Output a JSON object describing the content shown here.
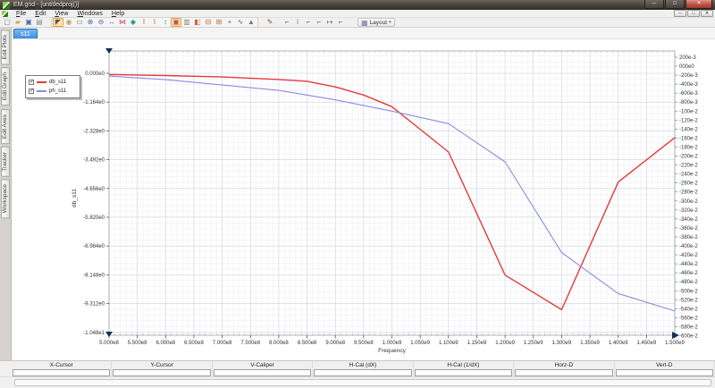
{
  "window": {
    "title": "EM.grid - [untitledproj()]",
    "controls": {
      "minimize": "─",
      "maximize": "□",
      "close": "✕"
    }
  },
  "menu": {
    "items": [
      "File",
      "Edit",
      "View",
      "Windows",
      "Help"
    ]
  },
  "child_controls": {
    "minimize": "─",
    "restore": "□",
    "close": "✕"
  },
  "toolbar": {
    "layout_label": "Layout",
    "groups": [
      {
        "name": "file-group",
        "panel": false,
        "icons": [
          {
            "name": "new-document-icon",
            "glyph": "▢",
            "color": "#7a8aa0"
          },
          {
            "name": "open-folder-icon",
            "glyph": "▰",
            "color": "#d8a83a"
          },
          {
            "name": "save-icon",
            "glyph": "▣",
            "color": "#4a6fa5"
          },
          {
            "name": "print-icon",
            "glyph": "▤",
            "color": "#8a8a8a"
          }
        ]
      },
      {
        "name": "plot-tools-group",
        "panel": true,
        "icons": [
          {
            "name": "select-arrow-icon",
            "glyph": "◤",
            "color": "#555555",
            "active": true
          },
          {
            "name": "pan-hand-icon",
            "glyph": "◉",
            "color": "#c9a05a"
          },
          {
            "name": "zoom-window-icon",
            "glyph": "▭",
            "color": "#666666"
          },
          {
            "name": "zoom-in-icon",
            "glyph": "⊕",
            "color": "#4a6fa5"
          },
          {
            "name": "zoom-out-icon",
            "glyph": "⊖",
            "color": "#4a6fa5"
          },
          {
            "name": "zoom-x-icon",
            "glyph": "↔",
            "color": "#4a6fa5"
          },
          {
            "name": "marker-pair-icon",
            "glyph": "⋈",
            "color": "#c0504a"
          },
          {
            "name": "h-center-icon",
            "glyph": "◆",
            "color": "#2a9d9d"
          },
          {
            "name": "v-ibeam-icon",
            "glyph": "I",
            "color": "#d2691e"
          },
          {
            "name": "v-ibeam-arrows-icon",
            "glyph": "I",
            "color": "#d2691e"
          },
          {
            "name": "v-fit-icon",
            "glyph": "↕",
            "color": "#2a9d9d"
          },
          {
            "name": "active-marker-icon",
            "glyph": "▣",
            "color": "#c0504a",
            "active": true
          },
          {
            "name": "trace-marker-icon",
            "glyph": "▥",
            "color": "#888888"
          },
          {
            "name": "pane-left-icon",
            "glyph": "◧",
            "color": "#c06a3a"
          },
          {
            "name": "pane-bottom-icon",
            "glyph": "⊟",
            "color": "#c06a3a"
          },
          {
            "name": "pane-grid-icon",
            "glyph": "⊞",
            "color": "#c06a3a"
          },
          {
            "name": "add-trace-icon",
            "glyph": "+",
            "color": "#2a9d5d"
          },
          {
            "name": "wave-icon",
            "glyph": "∿",
            "color": "#4a6fa5"
          },
          {
            "name": "peak-icon",
            "glyph": "▲",
            "color": "#777777"
          }
        ]
      },
      {
        "name": "edit-group",
        "panel": false,
        "icons": [
          {
            "name": "pencil-icon",
            "glyph": "✎",
            "color": "#8b5a2b"
          }
        ]
      },
      {
        "name": "cursor-toggle-group",
        "panel": false,
        "icons": [
          {
            "name": "x-cursor-toggle-icon",
            "glyph": "⌐",
            "color": "#666666"
          },
          {
            "name": "y-cursor-toggle-icon",
            "glyph": "i",
            "color": "#3a9d3a"
          },
          {
            "name": "v-caliper-toggle-icon",
            "glyph": "⌐",
            "color": "#666666"
          },
          {
            "name": "h-caliper-toggle-icon",
            "glyph": "⌐",
            "color": "#666666"
          },
          {
            "name": "delta-caliper-toggle-icon",
            "glyph": "↦",
            "color": "#666666"
          },
          {
            "name": "caliper-toggle-icon",
            "glyph": "⌐",
            "color": "#666666"
          }
        ]
      }
    ],
    "layout_icon": "▦",
    "layout_caret": "▾"
  },
  "sidebar": {
    "tabs": [
      "Edit Plots",
      "Edit Graph",
      "Edit Axes",
      "Tracker",
      "Workspace"
    ]
  },
  "doc_tabs": [
    {
      "label": "s11",
      "active": true
    }
  ],
  "legend": {
    "items": [
      {
        "label": "db_s11",
        "color": "#e23b3b",
        "checked": true
      },
      {
        "label": "ph_s11",
        "color": "#8d8ae0",
        "checked": true
      }
    ]
  },
  "chart_data": {
    "type": "line",
    "xlabel": "Frequency",
    "ylabel_left": "db_s11",
    "x_range": [
      500000000,
      1500000000
    ],
    "x_minor_step": 10000000,
    "x_major_step": 50000000,
    "x_tick_labels": [
      "5.000e8",
      "5.500e8",
      "6.000e8",
      "6.500e8",
      "7.000e8",
      "7.500e8",
      "8.000e8",
      "8.500e8",
      "9.000e8",
      "9.500e8",
      "1.000e9",
      "1.050e9",
      "1.100e9",
      "1.150e9",
      "1.200e9",
      "1.250e9",
      "1.300e9",
      "1.350e9",
      "1.400e9",
      "1.450e9",
      "1.500e9"
    ],
    "left_axis": {
      "labels": [
        "0.000e0",
        "-1.164e0",
        "-2.328e0",
        "-3.492e0",
        "-4.656e0",
        "-5.820e0",
        "-6.984e0",
        "-8.148e0",
        "-9.312e0",
        "-1.048e1"
      ],
      "values": [
        0,
        -1.164,
        -2.328,
        -3.492,
        -4.656,
        -5.82,
        -6.984,
        -8.148,
        -9.312,
        -10.476
      ]
    },
    "right_axis": {
      "labels": [
        "200e-3",
        "000e0",
        "-200e-3",
        "-400e-3",
        "-600e-3",
        "-800e-3",
        "-100e-2",
        "-120e-2",
        "-140e-2",
        "-160e-2",
        "-180e-2",
        "-200e-2",
        "-220e-2",
        "-240e-2",
        "-260e-2",
        "-280e-2",
        "-300e-2",
        "-320e-2",
        "-340e-2",
        "-360e-2",
        "-380e-2",
        "-400e-2",
        "-420e-2",
        "-440e-2",
        "-460e-2",
        "-480e-2",
        "-500e-2",
        "-520e-2",
        "-540e-2",
        "-560e-2",
        "-580e-2",
        "-600e-2"
      ],
      "top_value": 0.2,
      "step": -0.2
    },
    "series": [
      {
        "name": "db_s11",
        "axis": "left",
        "color": "#e23b3b",
        "width": 1.4,
        "x": [
          500000000,
          600000000,
          700000000,
          800000000,
          850000000,
          900000000,
          950000000,
          1000000000,
          1100000000,
          1200000000,
          1300000000,
          1400000000,
          1500000000
        ],
        "y": [
          -0.05,
          -0.09,
          -0.15,
          -0.25,
          -0.32,
          -0.55,
          -0.88,
          -1.35,
          -3.18,
          -8.16,
          -9.56,
          -4.4,
          -2.6
        ]
      },
      {
        "name": "ph_s11",
        "axis": "right",
        "color": "#8d8ae0",
        "width": 1.1,
        "x": [
          500000000,
          600000000,
          700000000,
          800000000,
          900000000,
          1000000000,
          1100000000,
          1200000000,
          1300000000,
          1400000000,
          1500000000
        ],
        "y": [
          -0.22,
          -0.3,
          -0.42,
          -0.54,
          -0.75,
          -1.0,
          -1.28,
          -2.13,
          -4.15,
          -5.06,
          -5.45
        ]
      }
    ]
  },
  "cursor_bar": {
    "fields": [
      {
        "label": "X-Cursor",
        "value": ""
      },
      {
        "label": "Y-Cursor",
        "value": ""
      },
      {
        "label": "V-Caliper",
        "value": ""
      },
      {
        "label": "H-Cal (dX)",
        "value": ""
      },
      {
        "label": "H-Cal (1/dX)",
        "value": ""
      },
      {
        "label": "Horz-D",
        "value": ""
      },
      {
        "label": "Vert-D",
        "value": ""
      }
    ]
  }
}
